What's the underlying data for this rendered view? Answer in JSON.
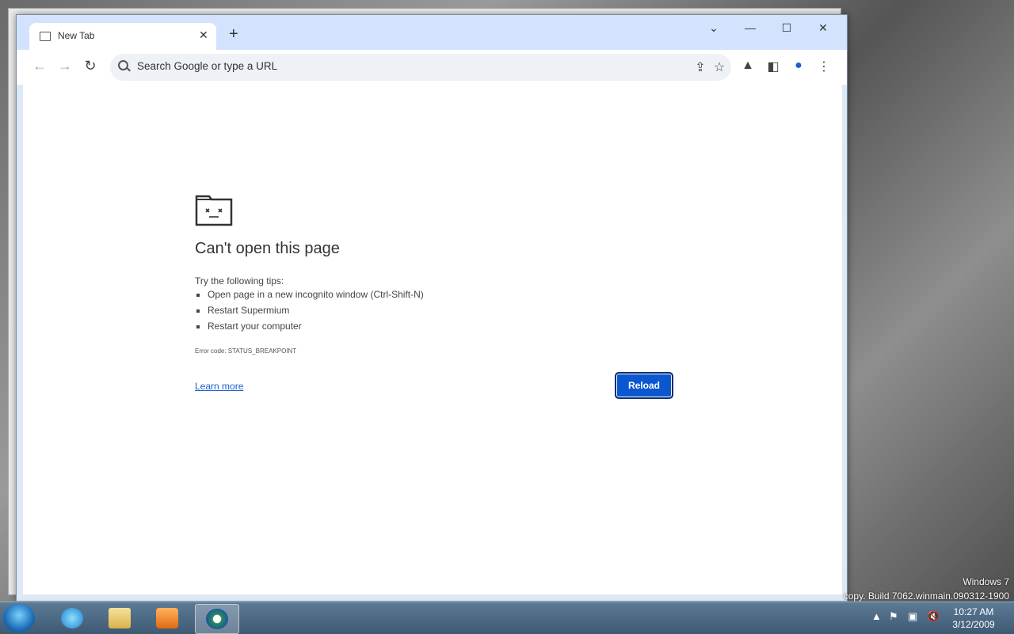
{
  "browser": {
    "tab_title": "New Tab",
    "omnibox_placeholder": "Search Google or type a URL"
  },
  "error_page": {
    "heading": "Can't open this page",
    "tips_intro": "Try the following tips:",
    "tips": [
      "Open page in a new incognito window (Ctrl-Shift-N)",
      "Restart Supermium",
      "Restart your computer"
    ],
    "error_code": "Error code: STATUS_BREAKPOINT",
    "learn_more": "Learn more",
    "reload_label": "Reload"
  },
  "desktop": {
    "watermark_line1": "Windows 7",
    "watermark_line2": "copy. Build 7062.winmain.090312-1900"
  },
  "taskbar": {
    "time": "10:27 AM",
    "date": "3/12/2009"
  },
  "colors": {
    "tabstrip": "#d3e3fd",
    "reload_button": "#0b57d0"
  }
}
